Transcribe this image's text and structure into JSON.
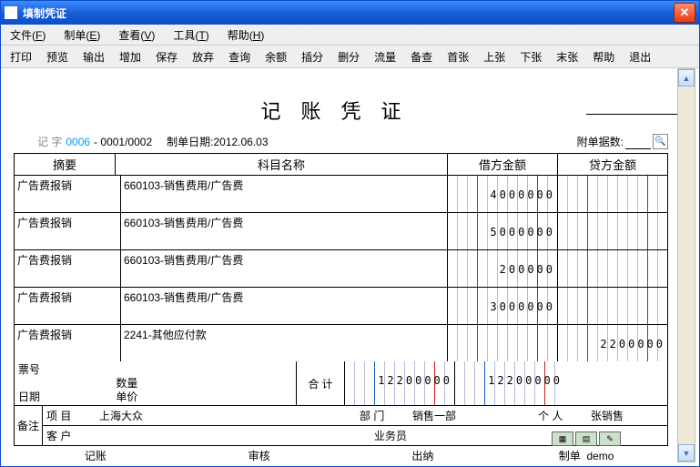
{
  "window": {
    "title": "填制凭证"
  },
  "menus": [
    {
      "label": "文件",
      "acc": "F"
    },
    {
      "label": "制单",
      "acc": "E"
    },
    {
      "label": "查看",
      "acc": "V"
    },
    {
      "label": "工具",
      "acc": "T"
    },
    {
      "label": "帮助",
      "acc": "H"
    }
  ],
  "toolbar": [
    "打印",
    "预览",
    "输出",
    "增加",
    "保存",
    "放弃",
    "查询",
    "余额",
    "插分",
    "删分",
    "流量",
    "备查",
    "首张",
    "上张",
    "下张",
    "末张",
    "帮助",
    "退出"
  ],
  "doc": {
    "title": "记账凭证",
    "seq_label": "记    字",
    "num_a": "0006",
    "num_b": "0001/0002",
    "date_label": "制单日期:",
    "date": "2012.06.03",
    "att_label": "附单据数:",
    "att_val": ""
  },
  "columns": {
    "summary": "摘要",
    "subject": "科目名称",
    "debit": "借方金额",
    "credit": "贷方金额"
  },
  "rows": [
    {
      "summary": "广告费报销",
      "subject": "660103-销售费用/广告费",
      "debit": "4000000",
      "credit": ""
    },
    {
      "summary": "广告费报销",
      "subject": "660103-销售费用/广告费",
      "debit": "5000000",
      "credit": ""
    },
    {
      "summary": "广告费报销",
      "subject": "660103-销售费用/广告费",
      "debit": "200000",
      "credit": ""
    },
    {
      "summary": "广告费报销",
      "subject": "660103-销售费用/广告费",
      "debit": "3000000",
      "credit": ""
    },
    {
      "summary": "广告费报销",
      "subject": "2241-其他应付款",
      "debit": "",
      "credit": "2200000"
    }
  ],
  "ticket": {
    "l1": "票号",
    "l2": "日期",
    "qty": "数量",
    "price": "单价",
    "sum_label": "合 计",
    "debit_total": "12200000",
    "credit_total": "12200000"
  },
  "foot": {
    "bz": "备注",
    "proj_lbl": "项  目",
    "proj_val": "上海大众",
    "cust_lbl": "客  户",
    "dept_lbl": "部  门",
    "dept_val": "销售一部",
    "biz_lbl": "业务员",
    "person_lbl": "个  人",
    "person_val": "张销售"
  },
  "sig": {
    "a": "记账",
    "b": "审核",
    "c": "出纳",
    "d": "制单",
    "d_val": "demo"
  }
}
